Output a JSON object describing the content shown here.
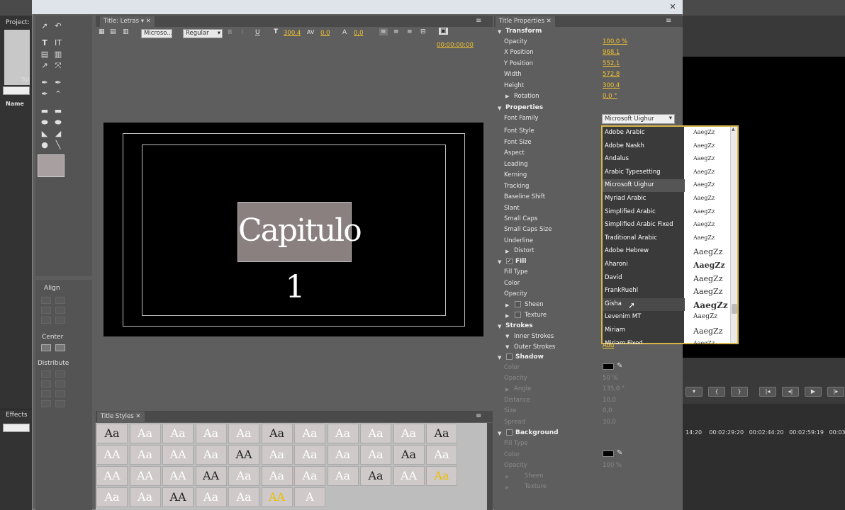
{
  "left_panel": {
    "project_label": "Project:",
    "tut_label": "Tut",
    "name_col": "Name",
    "effects_label": "Effects"
  },
  "main_tab": {
    "label": "Title: Letras"
  },
  "toolbar": {
    "font": "Microso...",
    "style": "Regular",
    "size_value": "300,4",
    "kerning_value": "0,0",
    "baseline_value": "0,0",
    "timecode": "00:00:00:00"
  },
  "canvas": {
    "title_text": "Capitulo 1"
  },
  "align": {
    "align_label": "Align",
    "center_label": "Center",
    "distribute_label": "Distribute"
  },
  "styles": {
    "tab_label": "Title Styles",
    "swatches": [
      "Aa",
      "Aa",
      "Aa",
      "Aa",
      "Aa",
      "Aa",
      "Aa",
      "Aa",
      "Aa",
      "Aa",
      "Aa",
      "AA",
      "Aa",
      "AA",
      "Aa",
      "AA",
      "Aa",
      "Aa",
      "Aa",
      "Aa",
      "Aa",
      "Aa",
      "AA",
      "AA",
      "AA",
      "AA",
      "Aa",
      "Aa",
      "Aa",
      "Aa",
      "Aa",
      "AA",
      "Aa",
      "Aa",
      "Aa",
      "AA",
      "Aa",
      "Aa",
      "AA",
      "A"
    ]
  },
  "props": {
    "tab_label": "Title Properties",
    "transform": "Transform",
    "opacity_label": "Opacity",
    "opacity": "100,0 %",
    "xpos_label": "X Position",
    "xpos": "968,1",
    "ypos_label": "Y Position",
    "ypos": "552,1",
    "width_label": "Width",
    "width": "572,8",
    "height_label": "Height",
    "height": "300,4",
    "rotation_label": "Rotation",
    "rotation": "0,0 °",
    "properties": "Properties",
    "font_family": "Font Family",
    "font_family_value": "Microsoft Uighur",
    "font_style": "Font Style",
    "font_size": "Font Size",
    "aspect": "Aspect",
    "leading": "Leading",
    "kerning": "Kerning",
    "tracking": "Tracking",
    "baseline_shift": "Baseline Shift",
    "slant": "Slant",
    "small_caps": "Small Caps",
    "small_caps_size": "Small Caps Size",
    "underline": "Underline",
    "distort": "Distort",
    "fill": "Fill",
    "fill_type": "Fill Type",
    "color": "Color",
    "fill_opacity": "Opacity",
    "sheen": "Sheen",
    "texture": "Texture",
    "strokes": "Strokes",
    "inner_strokes": "Inner Strokes",
    "outer_strokes": "Outer Strokes",
    "add": "Add",
    "shadow": "Shadow",
    "sh_color": "Color",
    "sh_opacity": "Opacity",
    "sh_opacity_val": "50 %",
    "sh_angle": "Angle",
    "sh_angle_val": "135,0 °",
    "sh_distance": "Distance",
    "sh_distance_val": "10,0",
    "sh_size": "Size",
    "sh_size_val": "0,0",
    "sh_spread": "Spread",
    "sh_spread_val": "30,0",
    "background": "Background",
    "bg_fill_type": "Fill Type",
    "bg_color": "Color",
    "bg_opacity": "Opacity",
    "bg_opacity_val": "100 %",
    "bg_sheen": "Sheen",
    "bg_texture": "Texture"
  },
  "font_list": [
    {
      "name": "Adobe Arabic",
      "sample": "AaegZz"
    },
    {
      "name": "Adobe Naskh",
      "sample": "AaegZz"
    },
    {
      "name": "Andalus",
      "sample": "AaegZz"
    },
    {
      "name": "Arabic Typesetting",
      "sample": "AaegZz"
    },
    {
      "name": "Microsoft Uighur",
      "sample": "AaegZz"
    },
    {
      "name": "Myriad Arabic",
      "sample": "AaegZz"
    },
    {
      "name": "Simplified Arabic",
      "sample": "AaegZz"
    },
    {
      "name": "Simplified Arabic Fixed",
      "sample": "AaegZz"
    },
    {
      "name": "Traditional Arabic",
      "sample": "AaegZz"
    },
    {
      "name": "Adobe Hebrew",
      "sample": "AaegZz"
    },
    {
      "name": "Aharoni",
      "sample": "AaegZz"
    },
    {
      "name": "David",
      "sample": "AaegZz"
    },
    {
      "name": "FrankRuehl",
      "sample": "AaegZz"
    },
    {
      "name": "Gisha",
      "sample": "AaegZz"
    },
    {
      "name": "Levenim MT",
      "sample": "AaegZz"
    },
    {
      "name": "Miriam",
      "sample": "AaegZz"
    },
    {
      "name": "Miriam Fixed",
      "sample": "AaegZz"
    }
  ],
  "monitor": {
    "tc1": "14:20",
    "tc2": "00:02:29:20",
    "tc3": "00:02:44:20",
    "tc4": "00:02:59:19",
    "tc5": "00:03"
  }
}
